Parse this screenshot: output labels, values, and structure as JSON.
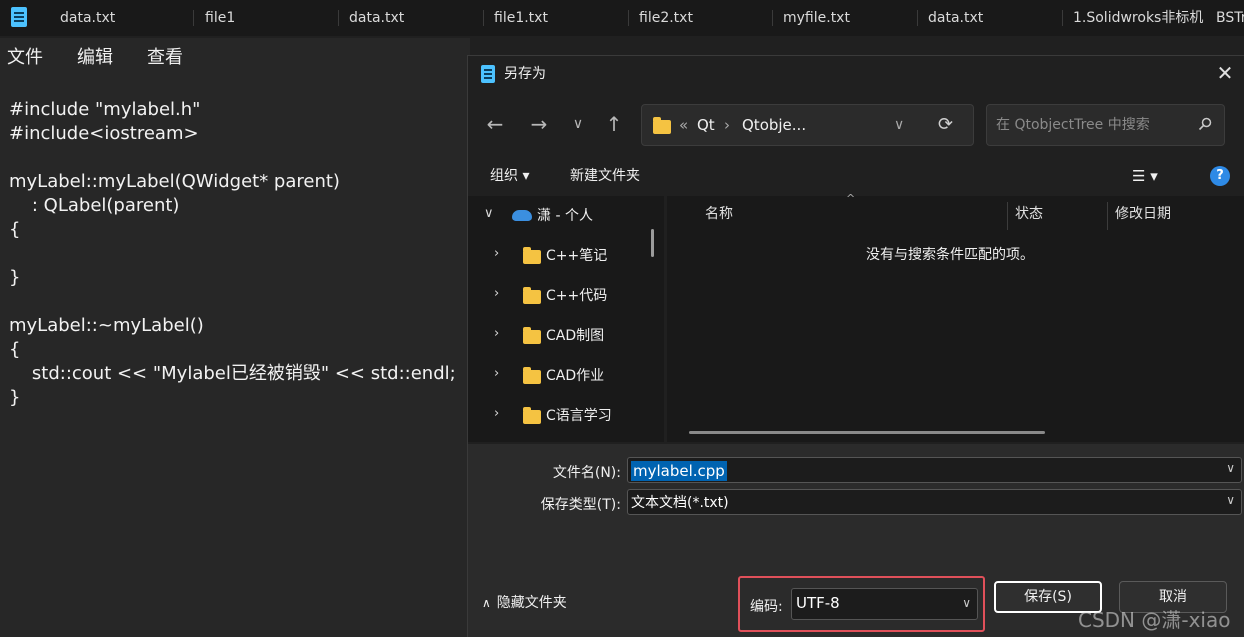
{
  "tabs": [
    "data.txt",
    "file1",
    "data.txt",
    "file1.txt",
    "file2.txt",
    "myfile.txt",
    "data.txt",
    "1.Solidwroks非标机",
    "BSTr"
  ],
  "notepad": {
    "menu": [
      "文件",
      "编辑",
      "查看"
    ],
    "code": [
      "#include \"mylabel.h\"",
      "#include<iostream>",
      "",
      "myLabel::myLabel(QWidget* parent)",
      "    : QLabel(parent)",
      "{",
      "",
      "}",
      "",
      "myLabel::~myLabel()",
      "{",
      "    std::cout << \"Mylabel已经被销毁\" << std::endl;",
      "}"
    ]
  },
  "dialog": {
    "title": "另存为",
    "close": "✕",
    "nav": {
      "back": "←",
      "forward": "→",
      "recent": "∨",
      "up": "↑",
      "refresh": "⟳",
      "dropdown": "∨"
    },
    "address": {
      "overflow": "«",
      "sep": "›",
      "crumb1": "Qt",
      "crumb2": "Qtobje..."
    },
    "search_placeholder": "在 QtobjectTree 中搜索",
    "commands": {
      "organize": "组织 ▾",
      "new_folder": "新建文件夹",
      "view": "☰ ▾",
      "help": "?"
    },
    "tree": [
      {
        "label": "潇 - 个人",
        "expanded": true
      },
      {
        "label": "C++笔记"
      },
      {
        "label": "C++代码"
      },
      {
        "label": "CAD制图"
      },
      {
        "label": "CAD作业"
      },
      {
        "label": "C语言学习"
      }
    ],
    "columns": [
      "名称",
      "状态",
      "修改日期"
    ],
    "empty_message": "没有与搜索条件匹配的项。",
    "filename_label": "文件名(N):",
    "filename_value": "mylabel.cpp",
    "filetype_label": "保存类型(T):",
    "filetype_value": "文本文档(*.txt)",
    "hide_folders": "隐藏文件夹",
    "encoding_label": "编码:",
    "encoding_value": "UTF-8",
    "save_button": "保存(S)",
    "cancel_button": "取消"
  },
  "watermark": "CSDN @潇-xiao",
  "colors": {
    "accent": "#0063b1",
    "highlight_box": "#e0505a",
    "folder": "#f5c342"
  }
}
